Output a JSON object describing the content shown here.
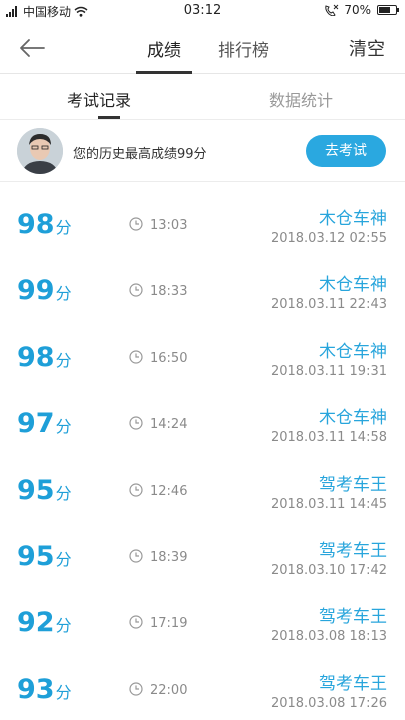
{
  "status_bar": {
    "carrier": "中国移动",
    "time": "03:12",
    "battery": "70%",
    "battery_level": 0.7
  },
  "nav": {
    "tabs": [
      {
        "label": "成绩",
        "active": true
      },
      {
        "label": "排行榜",
        "active": false
      }
    ],
    "clear_label": "清空"
  },
  "sub_tabs": [
    {
      "label": "考试记录",
      "active": true
    },
    {
      "label": "数据统计",
      "active": false
    }
  ],
  "profile": {
    "best_text": "您的历史最高成绩99分",
    "exam_button": "去考试"
  },
  "records": [
    {
      "score": "98",
      "unit": "分",
      "duration": "13:03",
      "title": "木仓车神",
      "date": "2018.03.12  02:55"
    },
    {
      "score": "99",
      "unit": "分",
      "duration": "18:33",
      "title": "木仓车神",
      "date": "2018.03.11  22:43"
    },
    {
      "score": "98",
      "unit": "分",
      "duration": "16:50",
      "title": "木仓车神",
      "date": "2018.03.11  19:31"
    },
    {
      "score": "97",
      "unit": "分",
      "duration": "14:24",
      "title": "木仓车神",
      "date": "2018.03.11  14:58"
    },
    {
      "score": "95",
      "unit": "分",
      "duration": "12:46",
      "title": "驾考车王",
      "date": "2018.03.11  14:45"
    },
    {
      "score": "95",
      "unit": "分",
      "duration": "18:39",
      "title": "驾考车王",
      "date": "2018.03.10  17:42"
    },
    {
      "score": "92",
      "unit": "分",
      "duration": "17:19",
      "title": "驾考车王",
      "date": "2018.03.08  18:13"
    },
    {
      "score": "93",
      "unit": "分",
      "duration": "22:00",
      "title": "驾考车王",
      "date": "2018.03.08  17:26"
    }
  ],
  "colors": {
    "accent": "#1e9fd8",
    "button": "#2aa8e0"
  }
}
